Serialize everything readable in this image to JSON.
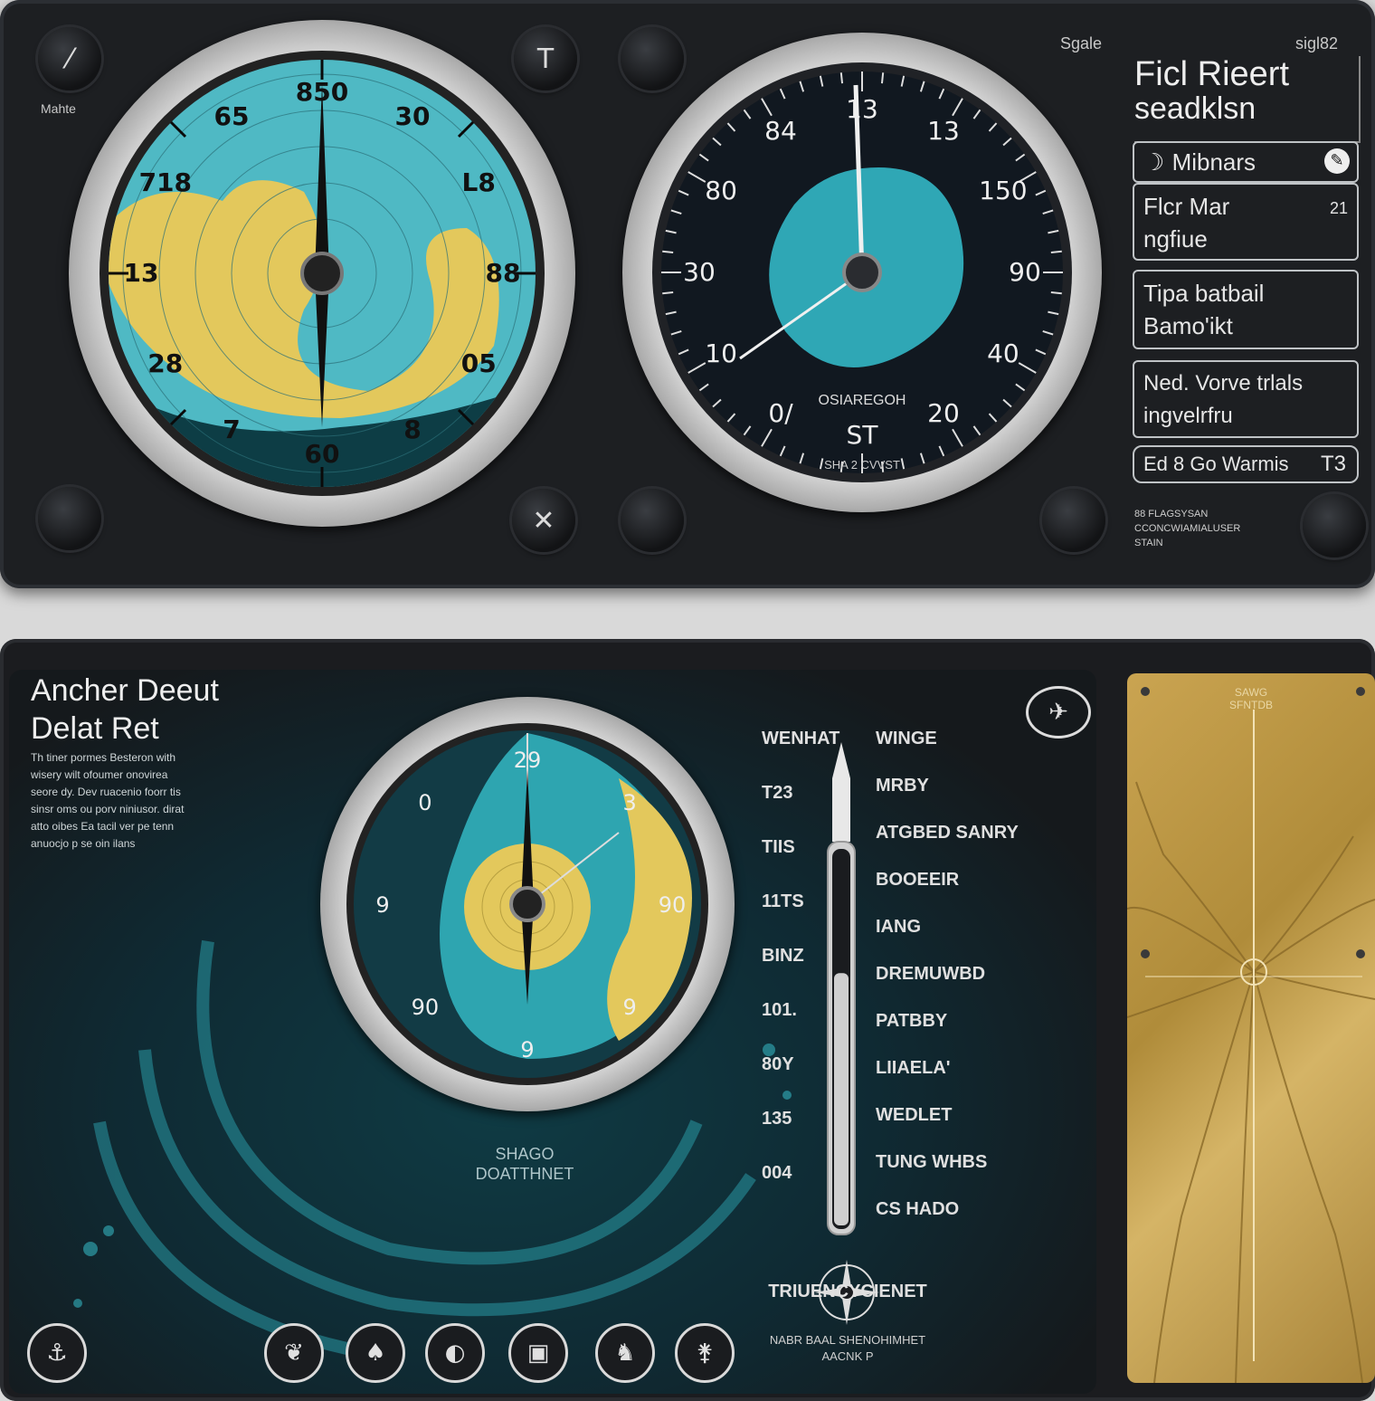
{
  "top": {
    "left_knob_label": "Mahte",
    "top_right_labels": [
      "Sgale",
      "sigl82"
    ],
    "gauge1": {
      "numbers": [
        "850",
        "30",
        "L8",
        "88",
        "05",
        "8",
        "60",
        "7",
        "28",
        "13",
        "718",
        "65"
      ],
      "colors": {
        "sea": "#4fb9c4",
        "land": "#e3c85c",
        "deep": "#0d3d45"
      }
    },
    "gauge2": {
      "numbers": [
        "13",
        "13",
        "150",
        "90",
        "40",
        "20",
        "ST",
        "0/",
        "10",
        "30",
        "80",
        "84"
      ],
      "caption": "OSIAREGOH",
      "sub_caption": "SHA 2 CVVST",
      "colors": {
        "face": "#111820",
        "radar": "#2fa7b5"
      }
    },
    "sidebar": {
      "heading_line1": "Ficl Rieert",
      "heading_line2": "seadklsn",
      "row1": "Mibnars",
      "row2_line1": "Flcr Mar",
      "row2_line2": "ngfiue",
      "row2_value": "21",
      "row3_line1": "Tipa batbail",
      "row3_line2": "Bamo'ikt",
      "row4_line1": "Ned. Vorve trlals",
      "row4_line2": "ingvelrfru",
      "row5_label": "Ed 8 Go Warmis",
      "row5_value": "T3",
      "footer_line1": "88 FLAGSYSAN",
      "footer_line2": "CCONCWIAMIALUSER",
      "footer_line3": "STAIN"
    }
  },
  "bottom": {
    "title_line1": "Ancher Deeut",
    "title_line2": "Delat Ret",
    "description": [
      "Th tiner pormes Besteron with",
      "wisery wilt ofoumer onovirea",
      "seore dy. Dev ruacenio foorr tis",
      "sinsr oms ou porv niniusor. dirat",
      "atto oibes Ea tacil ver pe tenn",
      "anuocjo p se oin ilans"
    ],
    "gauge3": {
      "numbers": [
        "29",
        "3",
        "90",
        "9",
        "9",
        "90",
        "9",
        "0"
      ],
      "caption_line1": "SHAGO",
      "caption_line2": "DOATTHNET"
    },
    "scale_left": [
      "WENHAT",
      "T23",
      "TIIS",
      "11TS",
      "BINZ",
      "101.",
      "80Y",
      "135",
      "004"
    ],
    "scale_right": [
      "WINGE",
      "MRBY",
      "ATGBED SANRY",
      "BOOEEIR",
      "IANG",
      "DREMUWBD",
      "PATBBY",
      "LIIAELA'",
      "WEDLET",
      "TUNG WHBS",
      "CS HADO"
    ],
    "thermometer_fill_pct": 68,
    "compass_label": "TRIUENCYCIENET",
    "compass_sub_line1": "NABR BAAL SHENOHIMHET",
    "compass_sub_line2": "AACNK P",
    "brass_label_line1": "SAWG",
    "brass_label_line2": "SFNTDB",
    "bottom_icons": [
      "anchor-icon",
      "octopus-icon",
      "diver-icon",
      "fish-icon",
      "tank-icon",
      "buoy-icon",
      "ship-icon"
    ],
    "bottom_icon_glyphs": [
      "⚓",
      "❦",
      "♠",
      "◐",
      "▣",
      "♞",
      "⚵"
    ],
    "colors": {
      "brass": "#c7a14d",
      "teal": "#2ea5b0"
    }
  }
}
